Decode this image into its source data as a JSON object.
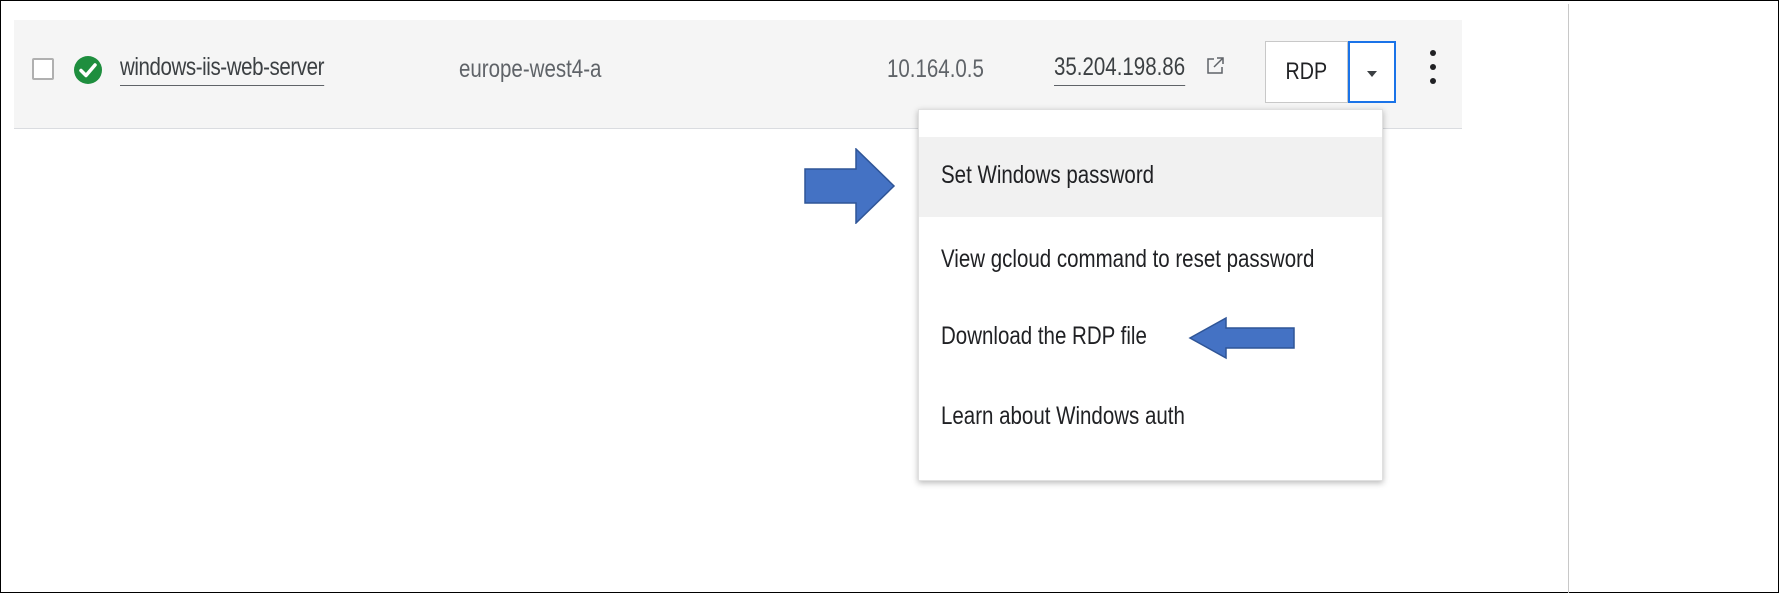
{
  "instance_row": {
    "name": "windows-iis-web-server",
    "status": "running",
    "zone": "europe-west4-a",
    "internal_ip": "10.164.0.5",
    "external_ip": "35.204.198.86",
    "connect_button": "RDP"
  },
  "rdp_menu": {
    "items": [
      "Set Windows password",
      "View gcloud command to reset password",
      "Download the RDP file",
      "Learn about Windows auth"
    ],
    "highlighted_index": 0
  },
  "colors": {
    "status_green": "#1e8e3e",
    "annotation_arrow": "#4472c4",
    "dropdown_border": "#1a73e8"
  },
  "icons": [
    "checkbox-icon",
    "check-circle-icon",
    "external-link-icon",
    "caret-down-icon",
    "more-vert-icon",
    "arrow-right-annotation",
    "arrow-left-annotation"
  ]
}
